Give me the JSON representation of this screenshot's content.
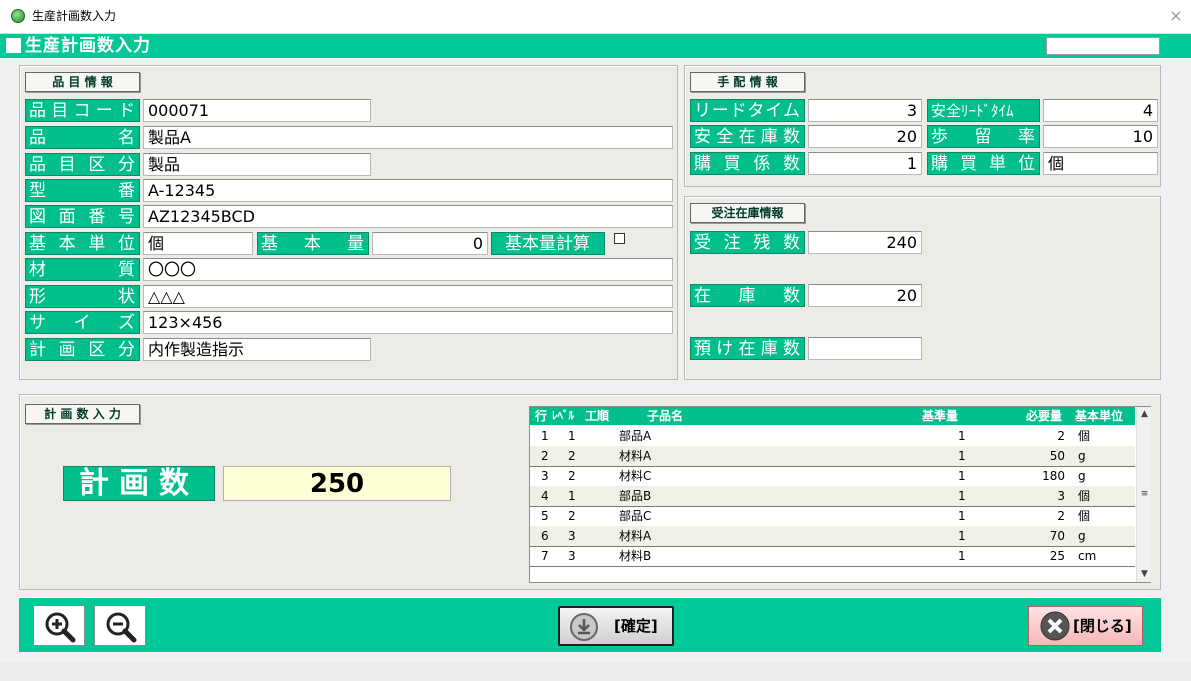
{
  "window": {
    "title": "生産計画数入力",
    "close_glyph": "×"
  },
  "header": {
    "title": "生産計画数入力"
  },
  "item_info": {
    "section_title": "品 目 情 報",
    "fields": {
      "item_code": {
        "label": [
          "品",
          "目",
          "コ",
          "ー",
          "ド"
        ],
        "value": "000071"
      },
      "item_name": {
        "label": [
          "品",
          "名"
        ],
        "value": "製品A"
      },
      "item_category": {
        "label": [
          "品",
          "目",
          "区",
          "分"
        ],
        "value": "製品"
      },
      "model_no": {
        "label": [
          "型",
          "番"
        ],
        "value": "A-12345"
      },
      "drawing_no": {
        "label": [
          "図",
          "面",
          "番",
          "号"
        ],
        "value": "AZ12345BCD"
      },
      "base_unit": {
        "label": [
          "基",
          "本",
          "単",
          "位"
        ],
        "value": "個"
      },
      "base_qty": {
        "label": [
          "基",
          "本",
          "量"
        ],
        "value": "0"
      },
      "base_qty_calc": {
        "label": "基本量計算"
      },
      "material": {
        "label": [
          "材",
          "質"
        ],
        "value": "〇〇〇"
      },
      "shape": {
        "label": [
          "形",
          "状"
        ],
        "value": "△△△"
      },
      "size": {
        "label": [
          "サ",
          "イ",
          "ズ"
        ],
        "value": "123×456"
      },
      "plan_category": {
        "label": [
          "計",
          "画",
          "区",
          "分"
        ],
        "value": "内作製造指示"
      }
    }
  },
  "arrangement_info": {
    "section_title": "手 配 情 報",
    "lead_time": {
      "label": [
        "リ",
        "ー",
        "ド",
        "タ",
        "イ",
        "ム"
      ],
      "value": "3"
    },
    "safety_lead_time": {
      "label": "安全ﾘｰﾄﾞﾀｲﾑ",
      "value": "4"
    },
    "safety_stock": {
      "label": [
        "安",
        "全",
        "在",
        "庫",
        "数"
      ],
      "value": "20"
    },
    "yield_rate": {
      "label": [
        "歩",
        "留",
        "率"
      ],
      "value": "10"
    },
    "purchase_factor": {
      "label": [
        "購",
        "買",
        "係",
        "数"
      ],
      "value": "1"
    },
    "purchase_unit": {
      "label": [
        "購",
        "買",
        "単",
        "位"
      ],
      "value": "個"
    }
  },
  "order_stock_info": {
    "section_title": "受注在庫情報",
    "order_backlog": {
      "label": [
        "受",
        "注",
        "残",
        "数"
      ],
      "value": "240"
    },
    "stock_qty": {
      "label": [
        "在",
        "庫",
        "数"
      ],
      "value": "20"
    },
    "deposit_stock": {
      "label": [
        "預",
        "け",
        "在",
        "庫",
        "数"
      ],
      "value": ""
    }
  },
  "plan_input": {
    "section_title": "計 画 数 入 力",
    "plan_qty_label": "計画数",
    "plan_qty_value": "250"
  },
  "bom_grid": {
    "columns": [
      "行",
      "ﾚﾍﾞﾙ",
      "工順",
      "子品名",
      "基準量",
      "必要量",
      "基本単位"
    ],
    "rows": [
      {
        "row": "1",
        "level": "1",
        "name": "部品A",
        "std_qty": "1",
        "req_qty": "2",
        "unit": "個"
      },
      {
        "row": "2",
        "level": "2",
        "name": "材料A",
        "std_qty": "1",
        "req_qty": "50",
        "unit": "g"
      },
      {
        "row": "3",
        "level": "2",
        "name": "材料C",
        "std_qty": "1",
        "req_qty": "180",
        "unit": "g"
      },
      {
        "row": "4",
        "level": "1",
        "name": "部品B",
        "std_qty": "1",
        "req_qty": "3",
        "unit": "個"
      },
      {
        "row": "5",
        "level": "2",
        "name": "部品C",
        "std_qty": "1",
        "req_qty": "2",
        "unit": "個"
      },
      {
        "row": "6",
        "level": "3",
        "name": "材料A",
        "std_qty": "1",
        "req_qty": "70",
        "unit": "g"
      },
      {
        "row": "7",
        "level": "3",
        "name": "材料B",
        "std_qty": "1",
        "req_qty": "25",
        "unit": "cm"
      }
    ]
  },
  "footer": {
    "confirm_label": "[確定]",
    "close_label": "[閉じる]"
  },
  "colors": {
    "accent": "#00c896",
    "label_bg": "#00bf8c",
    "highlight_field": "#ffffd6"
  }
}
